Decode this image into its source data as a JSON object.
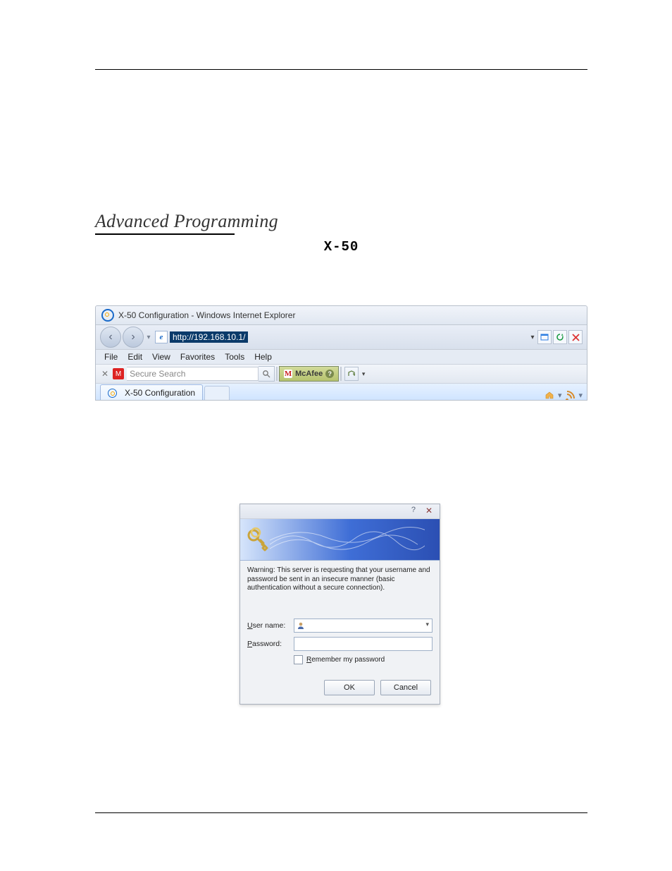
{
  "document": {
    "section_title": "Advanced Programming",
    "product_code": "X-50"
  },
  "browser": {
    "window_title": "X-50 Configuration - Windows Internet Explorer",
    "url": "http://192.168.10.1/",
    "menu": [
      "File",
      "Edit",
      "View",
      "Favorites",
      "Tools",
      "Help"
    ],
    "search_placeholder": "Secure Search",
    "toolbar_brand": "McAfee",
    "tab_title": "X-50 Configuration"
  },
  "dialog": {
    "warning": "Warning: This server is requesting that your username and password be sent in an insecure manner (basic authentication without a secure connection).",
    "username_label": "ser name:",
    "password_label": "assword:",
    "remember_label": "emember my password",
    "ok": "OK",
    "cancel": "Cancel"
  }
}
